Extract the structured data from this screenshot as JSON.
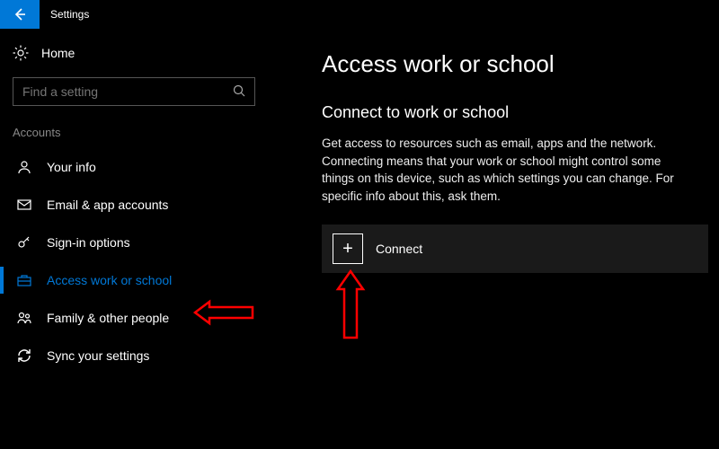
{
  "titlebar": {
    "app_name": "Settings"
  },
  "sidebar": {
    "home_label": "Home",
    "search_placeholder": "Find a setting",
    "section_label": "Accounts",
    "items": [
      {
        "label": "Your info"
      },
      {
        "label": "Email & app accounts"
      },
      {
        "label": "Sign-in options"
      },
      {
        "label": "Access work or school"
      },
      {
        "label": "Family & other people"
      },
      {
        "label": "Sync your settings"
      }
    ]
  },
  "main": {
    "heading": "Access work or school",
    "subheading": "Connect to work or school",
    "description": "Get access to resources such as email, apps and the network. Connecting means that your work or school might control some things on this device, such as which settings you can change. For specific info about this, ask them.",
    "connect_label": "Connect"
  }
}
